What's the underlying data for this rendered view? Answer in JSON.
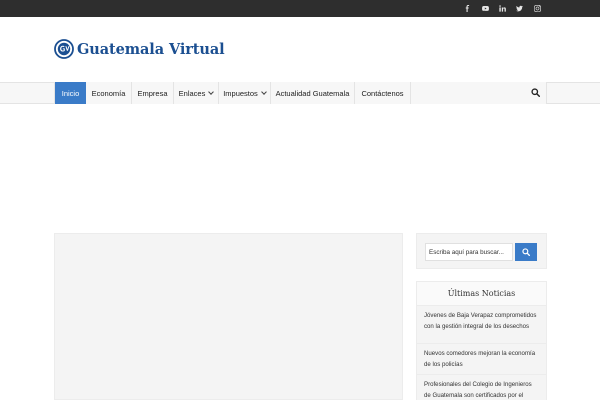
{
  "topbar": {
    "social": [
      "facebook-icon",
      "youtube-icon",
      "linkedin-icon",
      "twitter-icon",
      "instagram-icon"
    ],
    "background": "#2e2e2e"
  },
  "logo": {
    "word1": "Guatemala",
    "word2": "Virtual",
    "color": "#1b4f91"
  },
  "nav": {
    "items": [
      {
        "label": "Inicio",
        "active": true
      },
      {
        "label": "Economía"
      },
      {
        "label": "Empresa"
      },
      {
        "label": "Enlaces",
        "dropdown": true
      },
      {
        "label": "Impuestos",
        "dropdown": true
      },
      {
        "label": "Actualidad Guatemala"
      },
      {
        "label": "Contáctenos"
      }
    ],
    "accent": "#3a7bc8"
  },
  "sidebar": {
    "search_placeholder": "Escriba aquí para buscar...",
    "news_title": "Últimas Noticias",
    "news": [
      "Jóvenes de Baja Verapaz comprometidos con la gestión integral de los desechos",
      "Nuevos comedores mejoran la economía de los policías",
      "Profesionales del Colegio de Ingenieros de Guatemala son certificados por el"
    ]
  }
}
